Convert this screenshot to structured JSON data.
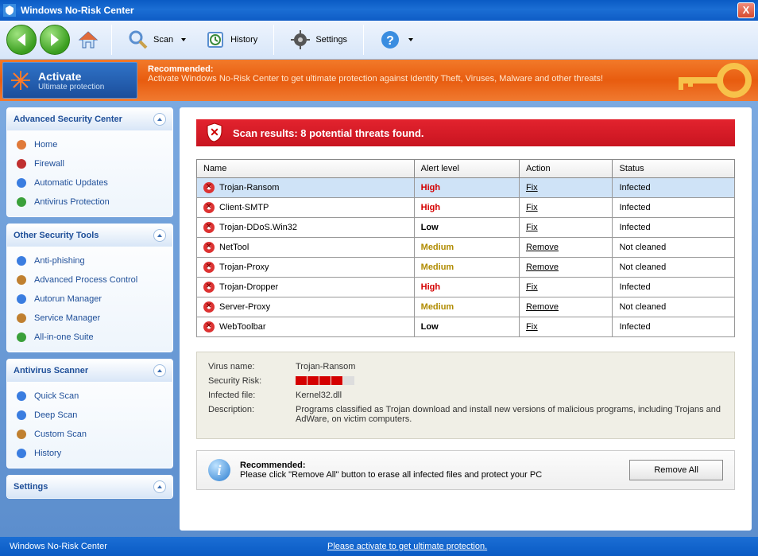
{
  "title": "Windows No-Risk Center",
  "toolbar": {
    "scan": "Scan",
    "history": "History",
    "settings": "Settings"
  },
  "activate": {
    "title": "Activate",
    "sub": "Ultimate protection"
  },
  "banner": {
    "heading": "Recommended:",
    "body": "Activate Windows No-Risk Center to get ultimate protection against Identity Theft, Viruses, Malware and other threats!"
  },
  "sidebar": {
    "panels": [
      {
        "title": "Advanced Security Center",
        "items": [
          "Home",
          "Firewall",
          "Automatic Updates",
          "Antivirus Protection"
        ]
      },
      {
        "title": "Other Security Tools",
        "items": [
          "Anti-phishing",
          "Advanced Process Control",
          "Autorun Manager",
          "Service Manager",
          "All-in-one Suite"
        ]
      },
      {
        "title": "Antivirus Scanner",
        "items": [
          "Quick Scan",
          "Deep Scan",
          "Custom Scan",
          "History"
        ]
      },
      {
        "title": "Settings",
        "items": []
      }
    ]
  },
  "scan_results_header": "Scan results: 8 potential threats found.",
  "columns": {
    "name": "Name",
    "alert": "Alert level",
    "action": "Action",
    "status": "Status"
  },
  "threats": [
    {
      "name": "Trojan-Ransom",
      "alert": "High",
      "action": "Fix",
      "status": "Infected",
      "sel": true
    },
    {
      "name": "Client-SMTP",
      "alert": "High",
      "action": "Fix",
      "status": "Infected"
    },
    {
      "name": "Trojan-DDoS.Win32",
      "alert": "Low",
      "action": "Fix",
      "status": "Infected"
    },
    {
      "name": "NetTool",
      "alert": "Medium",
      "action": "Remove",
      "status": "Not cleaned"
    },
    {
      "name": "Trojan-Proxy",
      "alert": "Medium",
      "action": "Remove",
      "status": "Not cleaned"
    },
    {
      "name": "Trojan-Dropper",
      "alert": "High",
      "action": "Fix",
      "status": "Infected"
    },
    {
      "name": "Server-Proxy",
      "alert": "Medium",
      "action": "Remove",
      "status": "Not cleaned"
    },
    {
      "name": "WebToolbar",
      "alert": "Low",
      "action": "Fix",
      "status": "Infected"
    }
  ],
  "details": {
    "virus_name_lbl": "Virus name:",
    "virus_name": "Trojan-Ransom",
    "risk_lbl": "Security Risk:",
    "risk_level": 4,
    "infected_lbl": "Infected file:",
    "infected_file": "Kernel32.dll",
    "desc_lbl": "Description:",
    "desc": "Programs classified as Trojan download and install new versions of malicious programs, including Trojans and AdWare, on victim computers."
  },
  "recommend": {
    "title": "Recommended:",
    "body": "Please click \"Remove All\" button to erase all infected files and protect your PC",
    "button": "Remove All"
  },
  "statusbar": {
    "left": "Windows No-Risk Center",
    "link": "Please activate to get ultimate protection."
  }
}
